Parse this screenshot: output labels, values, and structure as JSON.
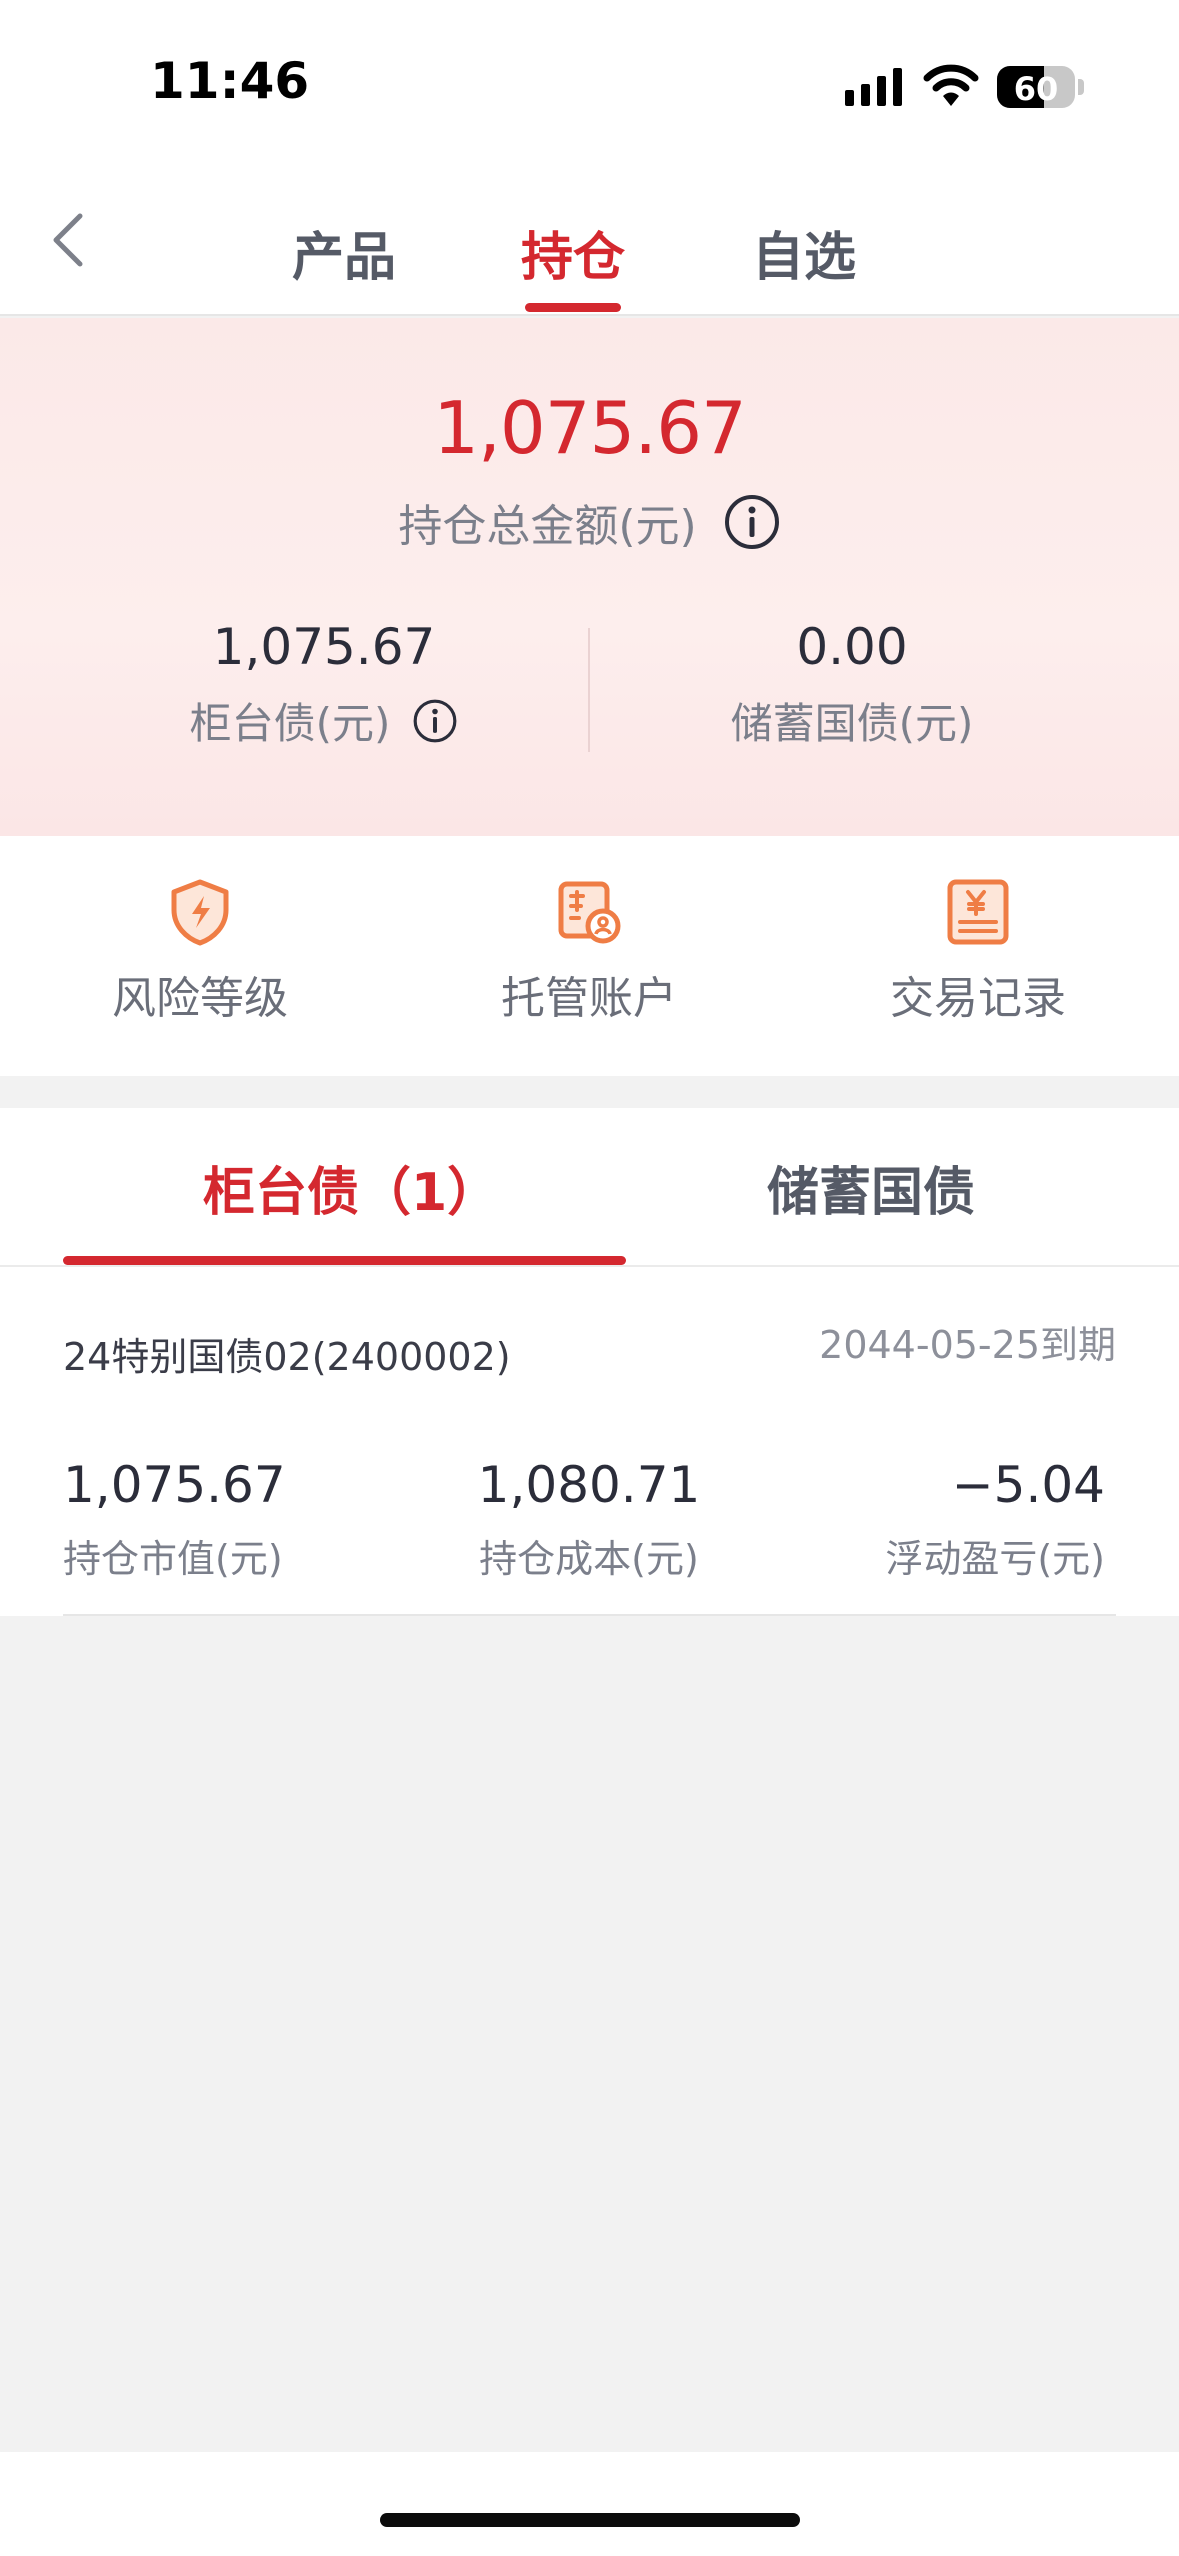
{
  "status_bar": {
    "time": "11:46",
    "battery": "60",
    "battery_level": 0.6
  },
  "nav": {
    "tabs": [
      {
        "label": "产品"
      },
      {
        "label": "持仓"
      },
      {
        "label": "自选"
      }
    ]
  },
  "summary": {
    "total_amount": "1,075.67",
    "total_label": "持仓总金额(元)",
    "left": {
      "value": "1,075.67",
      "label": "柜台债(元)"
    },
    "right": {
      "value": "0.00",
      "label": "储蓄国债(元)"
    }
  },
  "shortcuts": [
    {
      "label": "风险等级",
      "icon": "shield-bolt-icon"
    },
    {
      "label": "托管账户",
      "icon": "account-card-icon"
    },
    {
      "label": "交易记录",
      "icon": "yen-receipt-icon"
    }
  ],
  "holdings": {
    "tabs": [
      {
        "label": "柜台债（1）"
      },
      {
        "label": "储蓄国债"
      }
    ],
    "items": [
      {
        "name": "24特别国债02(2400002)",
        "maturity": "2044-05-25到期",
        "market_value": "1,075.67",
        "market_value_label": "持仓市值(元)",
        "cost": "1,080.71",
        "cost_label": "持仓成本(元)",
        "pnl": "−5.04",
        "pnl_label": "浮动盈亏(元)"
      }
    ]
  },
  "colors": {
    "accent": "#d4282f",
    "icon_orange": "#ef7d45"
  }
}
